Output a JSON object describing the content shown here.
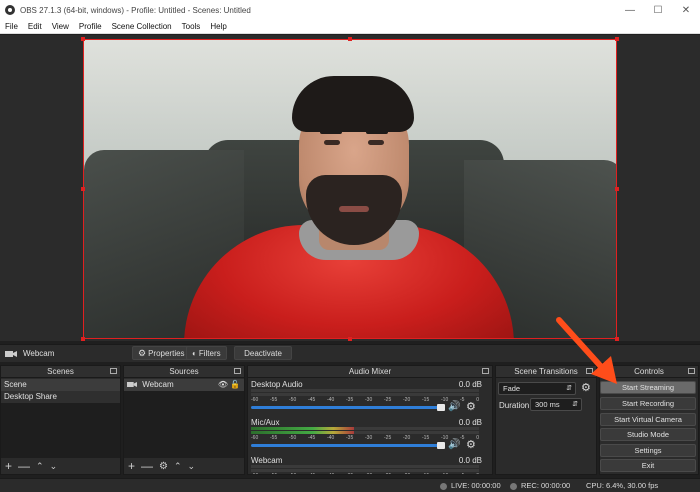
{
  "window": {
    "title": "OBS 27.1.3 (64-bit, windows) - Profile: Untitled - Scenes: Untitled",
    "controls": [
      "minimize",
      "maximize",
      "close"
    ]
  },
  "menu": [
    "File",
    "Edit",
    "View",
    "Profile",
    "Scene Collection",
    "Tools",
    "Help"
  ],
  "source_toolbar": {
    "source_name": "Webcam",
    "properties_label": "Properties",
    "filters_label": "Filters",
    "deactivate_label": "Deactivate"
  },
  "scenes": {
    "title": "Scenes",
    "items": [
      "Scene",
      "Desktop Share"
    ],
    "selected_index": 0
  },
  "sources": {
    "title": "Sources",
    "items": [
      {
        "name": "Webcam",
        "icon": "camera-icon"
      }
    ]
  },
  "audio_mixer": {
    "title": "Audio Mixer",
    "tick_labels": [
      "-60",
      "-55",
      "-50",
      "-45",
      "-40",
      "-35",
      "-30",
      "-25",
      "-20",
      "-15",
      "-10",
      "-5",
      "0"
    ],
    "channels": [
      {
        "name": "Desktop Audio",
        "db": "0.0 dB",
        "meter_level": 0.0,
        "volume": 1.0
      },
      {
        "name": "Mic/Aux",
        "db": "0.0 dB",
        "meter_level": 0.45,
        "volume": 1.0
      },
      {
        "name": "Webcam",
        "db": "0.0 dB",
        "meter_level": 0.0,
        "volume": 1.0
      }
    ]
  },
  "scene_transitions": {
    "title": "Scene Transitions",
    "transition": "Fade",
    "duration_label": "Duration",
    "duration_value": "300 ms"
  },
  "controls": {
    "title": "Controls",
    "buttons": [
      "Start Streaming",
      "Start Recording",
      "Start Virtual Camera",
      "Studio Mode",
      "Settings",
      "Exit"
    ]
  },
  "status": {
    "live": "LIVE: 00:00:00",
    "rec": "REC: 00:00:00",
    "cpu": "CPU: 6.4%, 30.00 fps"
  },
  "colors": {
    "selection_border": "#e02020",
    "annotation_arrow": "#ff4d1a",
    "volume_slider": "#2f7ed8"
  }
}
